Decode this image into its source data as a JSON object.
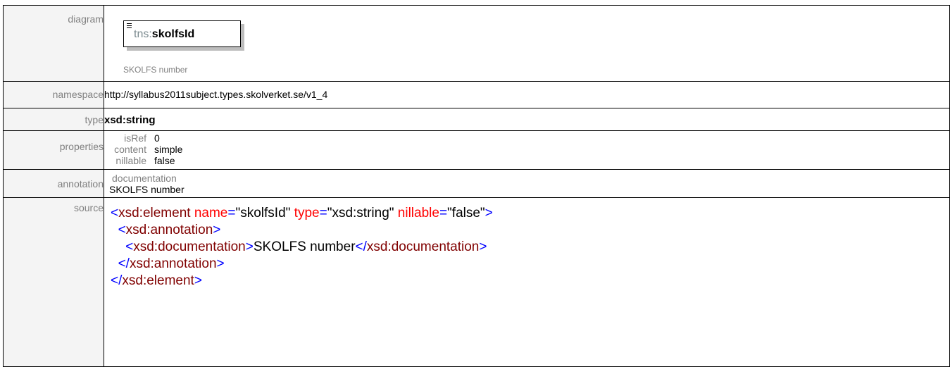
{
  "diagram": {
    "label": "diagram",
    "box_prefix": "tns:",
    "box_name": "skolfsId",
    "box_doc": "SKOLFS number"
  },
  "namespace": {
    "label": "namespace",
    "value": "http://syllabus2011subject.types.skolverket.se/v1_4"
  },
  "type": {
    "label": "type",
    "value": "xsd:string"
  },
  "properties": {
    "label": "properties",
    "items": [
      {
        "key": "isRef",
        "value": "0"
      },
      {
        "key": "content",
        "value": "simple"
      },
      {
        "key": "nillable",
        "value": "false"
      }
    ]
  },
  "annotation": {
    "label": "annotation",
    "title": "documentation",
    "text": "SKOLFS number"
  },
  "source": {
    "label": "source",
    "lines": {
      "l1": {
        "open": "<",
        "name": "xsd:element",
        "a1": " name",
        "eq1": "=",
        "v1": "\"skolfsId\"",
        "a2": " type",
        "eq2": "=",
        "v2": "\"xsd:string\"",
        "a3": " nillable",
        "eq3": "=",
        "v3": "\"false\"",
        "close": ">"
      },
      "l2": {
        "indent": "  ",
        "open": "<",
        "name": "xsd:annotation",
        "close": ">"
      },
      "l3": {
        "indent": "    ",
        "open": "<",
        "name": "xsd:documentation",
        "close": ">",
        "text": "SKOLFS number",
        "open2": "</",
        "name2": "xsd:documentation",
        "close2": ">"
      },
      "l4": {
        "indent": "  ",
        "open": "</",
        "name": "xsd:annotation",
        "close": ">"
      },
      "l5": {
        "open": "</",
        "name": "xsd:element",
        "close": ">"
      }
    }
  },
  "colors": {
    "tag_bracket": "#0000ff",
    "tag_name": "#800000",
    "attribute": "#ff0000",
    "label_text": "#808080",
    "label_bg": "#f4f4f4"
  }
}
